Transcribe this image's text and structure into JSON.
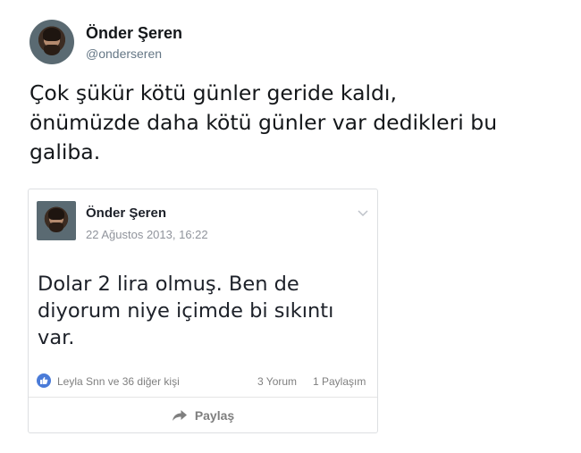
{
  "tweet": {
    "author_name": "Önder Şeren",
    "handle": "@onderseren",
    "text_lines": [
      "Çok şükür kötü günler geride kaldı,",
      "önümüzde daha kötü günler var dedikleri bu",
      "galiba."
    ]
  },
  "facebook_post": {
    "author_name": "Önder Şeren",
    "date": "22 Ağustos 2013, 16:22",
    "text_lines": [
      "Dolar 2 lira olmuş. Ben de",
      "diyorum niye içimde bi sıkıntı",
      "var."
    ],
    "likes_text": "Leyla Snn ve 36 diğer kişi",
    "comments_text": "3 Yorum",
    "shares_text": "1 Paylaşım",
    "share_button_label": "Paylaş",
    "icons": [
      "like-icon",
      "chevron-down-icon",
      "share-arrow-icon"
    ],
    "colors": {
      "like_blue": "#4a7bd8",
      "meta_gray": "#7f7f7f"
    }
  }
}
